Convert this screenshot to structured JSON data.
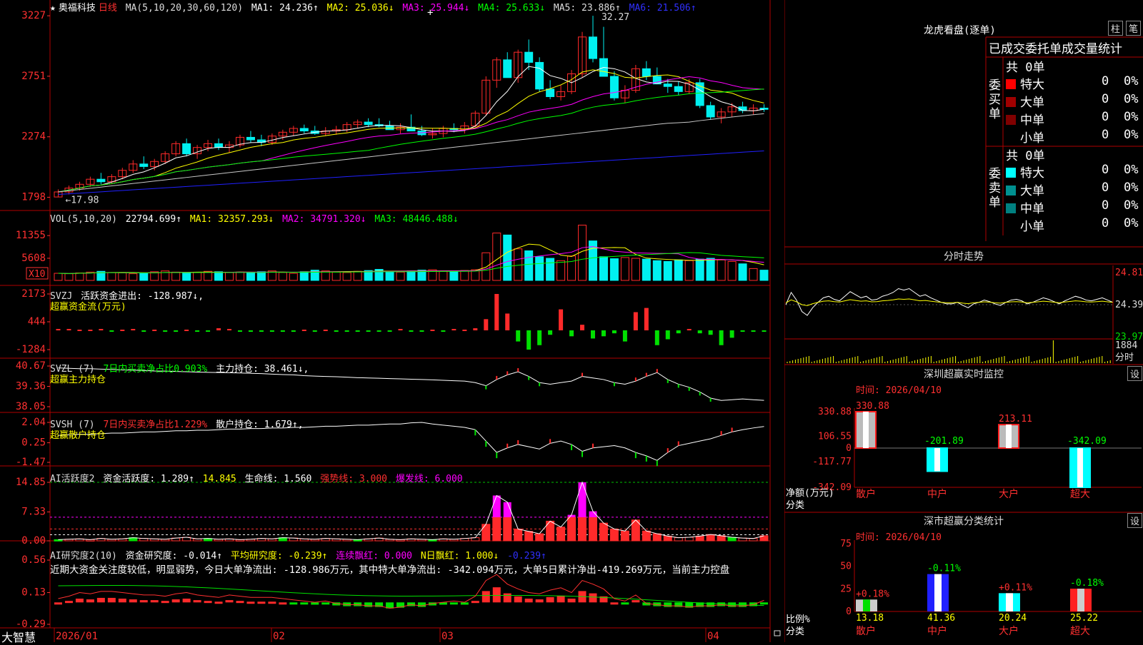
{
  "stock": {
    "star": "★",
    "name": "奥福科技",
    "period": "日线"
  },
  "colors": {
    "up": "#ff2a2a",
    "down": "#00f0f0",
    "ma1": "#ffffff",
    "ma2": "#ffff00",
    "ma3": "#ff00ff",
    "ma4": "#00ff00",
    "ma5": "#c8c8c8",
    "ma6": "#2020ff",
    "grid": "#b00000"
  },
  "main": {
    "ma_label": "MA(5,10,20,30,60,120)",
    "ma1": "MA1: 24.236↑",
    "ma2": "MA2: 25.036↓",
    "ma3": "MA3: 25.944↓",
    "ma4": "MA4: 25.633↓",
    "ma5": "MA5: 23.886↑",
    "ma6": "MA6: 21.506↑",
    "y_ticks": [
      "3227",
      "2751",
      "2274",
      "1798"
    ],
    "high_label": "32.27",
    "low_label": "←17.98",
    "plus": "+"
  },
  "vol": {
    "label": "VOL(5,10,20)",
    "value": "22794.699↑",
    "ma1": "MA1: 32357.293↓",
    "ma2": "MA2: 34791.320↓",
    "ma3": "MA3: 48446.488↓",
    "y_ticks": [
      "11355",
      "5608",
      "X10"
    ]
  },
  "svzj": {
    "label": "SVZJ",
    "desc": "活跃资金进出: -128.987↓,",
    "sub": "超赢资金流(万元)",
    "y_ticks": [
      "2173",
      "444",
      "-1284"
    ]
  },
  "svzl": {
    "label": "SVZL (7)",
    "desc1": "7日内买卖净占比0.903%",
    "desc2": "主力持仓: 38.461↓,",
    "sub": "超赢主力持仓",
    "y_ticks": [
      "40.67",
      "39.36",
      "38.05"
    ]
  },
  "svsh": {
    "label": "SVSH (7)",
    "desc1": "7日内买卖净占比1.229%",
    "desc2": "散户持仓: 1.679↑,",
    "sub": "超赢散户持仓",
    "y_ticks": [
      "2.04",
      "0.25",
      "-1.47"
    ]
  },
  "ai1": {
    "label": "AI活跃度2",
    "d1": "资金活跃度: 1.289↑",
    "d2": "14.845",
    "d3": "生命线: 1.560",
    "d4": "强势线: 3.000",
    "d5": "爆发线: 6.000",
    "y_ticks": [
      "14.85",
      "7.33",
      "0.00"
    ]
  },
  "ai2": {
    "label": "AI研究度2(10)",
    "d1": "资金研究度: -0.014↑",
    "d2": "平均研究度: -0.239↑",
    "d3": "连续飘红: 0.000",
    "d4": "N日飘红: 1.000↓",
    "d5": "-0.239↑",
    "comment": "近期大资金关注度较低，明显弱势，今日大单净流出: -128.986万元，其中特大单净流出: -342.094万元，大单5日累计净出-419.269万元，当前主力控盘",
    "y_ticks": [
      "0.56",
      "0.13",
      "-0.29"
    ]
  },
  "xaxis": {
    "logo": "大智慧",
    "dates": [
      "2026/01",
      "02",
      "03",
      "04"
    ]
  },
  "lhb": {
    "title": "龙虎看盘(逐单)",
    "btn1": "柱",
    "btn2": "笔",
    "tabs": [
      "已成交",
      "委托单",
      "成交量统计"
    ],
    "buy": {
      "group": "委买单",
      "total": "共 0单",
      "rows": [
        {
          "name": "特大",
          "v": "0",
          "p": "0%"
        },
        {
          "name": "大单",
          "v": "0",
          "p": "0%"
        },
        {
          "name": "中单",
          "v": "0",
          "p": "0%"
        },
        {
          "name": "小单",
          "v": "0",
          "p": "0%"
        }
      ]
    },
    "sell": {
      "group": "委卖单",
      "total": "共 0单",
      "rows": [
        {
          "name": "特大",
          "v": "0",
          "p": "0%"
        },
        {
          "name": "大单",
          "v": "0",
          "p": "0%"
        },
        {
          "name": "中单",
          "v": "0",
          "p": "0%"
        },
        {
          "name": "小单",
          "v": "0",
          "p": "0%"
        }
      ]
    }
  },
  "fenshi": {
    "title": "分时走势",
    "y_ticks": [
      "24.81",
      "24.39",
      "23.97"
    ],
    "vol_top": "1884",
    "vol_label": "分时"
  },
  "sz_monitor": {
    "title": "深圳超赢实时监控",
    "btn": "设",
    "time": "时间: 2026/04/10",
    "ylabel": "净额(万元)",
    "xlabel": "分类",
    "y_ticks": [
      "330.88",
      "106.55",
      "0",
      "-117.77",
      "-342.09"
    ]
  },
  "sz_class": {
    "title": "深市超赢分类统计",
    "btn": "设",
    "time": "时间: 2026/04/10",
    "ylabel": "比例%",
    "xlabel": "分类",
    "y_ticks": [
      "75",
      "50",
      "25",
      "0"
    ]
  },
  "chart_data": [
    {
      "type": "candlestick",
      "name": "奥福科技 日线",
      "ma_periods": [
        5,
        10,
        20,
        30,
        60,
        120
      ],
      "ohlc": [
        [
          18.0,
          18.6,
          17.98,
          18.4
        ],
        [
          18.4,
          18.9,
          18.2,
          18.7
        ],
        [
          18.7,
          19.2,
          18.5,
          19.0
        ],
        [
          19.0,
          19.6,
          18.8,
          19.4
        ],
        [
          19.4,
          19.9,
          19.0,
          19.2
        ],
        [
          19.2,
          19.8,
          19.0,
          19.6
        ],
        [
          19.6,
          20.3,
          19.4,
          20.1
        ],
        [
          20.1,
          20.9,
          19.9,
          20.6
        ],
        [
          20.6,
          21.2,
          20.2,
          20.4
        ],
        [
          20.4,
          21.0,
          20.1,
          20.8
        ],
        [
          20.8,
          21.6,
          20.6,
          21.4
        ],
        [
          21.4,
          22.4,
          21.2,
          22.2
        ],
        [
          22.2,
          22.6,
          21.2,
          21.4
        ],
        [
          21.4,
          22.1,
          21.0,
          21.9
        ],
        [
          21.9,
          22.5,
          21.6,
          22.2
        ],
        [
          22.2,
          22.6,
          21.7,
          21.9
        ],
        [
          21.9,
          22.4,
          21.5,
          22.1
        ],
        [
          22.1,
          22.9,
          21.9,
          22.7
        ],
        [
          22.7,
          23.2,
          22.3,
          22.5
        ],
        [
          22.5,
          22.9,
          22.0,
          22.3
        ],
        [
          22.3,
          23.0,
          22.1,
          22.8
        ],
        [
          22.8,
          23.3,
          22.5,
          23.1
        ],
        [
          23.1,
          23.6,
          22.8,
          23.4
        ],
        [
          23.4,
          23.7,
          23.0,
          23.2
        ],
        [
          23.2,
          23.6,
          22.9,
          23.0
        ],
        [
          23.0,
          23.5,
          22.8,
          23.2
        ],
        [
          23.2,
          23.6,
          22.9,
          23.3
        ],
        [
          23.3,
          23.9,
          23.1,
          23.7
        ],
        [
          23.7,
          24.1,
          23.4,
          23.9
        ],
        [
          23.9,
          24.2,
          23.5,
          23.7
        ],
        [
          23.7,
          24.2,
          23.5,
          23.6
        ],
        [
          23.6,
          24.0,
          23.3,
          23.3
        ],
        [
          23.3,
          23.8,
          23.0,
          23.5
        ],
        [
          23.5,
          24.5,
          23.2,
          23.2
        ],
        [
          23.2,
          23.6,
          22.8,
          22.9
        ],
        [
          22.9,
          23.4,
          22.6,
          23.0
        ],
        [
          23.0,
          23.6,
          22.7,
          23.4
        ],
        [
          23.4,
          23.8,
          23.1,
          23.3
        ],
        [
          23.3,
          23.9,
          23.0,
          23.6
        ],
        [
          23.6,
          24.8,
          23.5,
          24.6
        ],
        [
          24.6,
          27.5,
          24.4,
          27.2
        ],
        [
          27.2,
          29.0,
          26.6,
          28.8
        ],
        [
          28.8,
          29.4,
          27.6,
          27.4
        ],
        [
          27.4,
          29.6,
          27.0,
          29.4
        ],
        [
          29.4,
          30.4,
          28.0,
          28.6
        ],
        [
          28.6,
          29.0,
          26.3,
          26.5
        ],
        [
          26.5,
          27.2,
          25.7,
          25.9
        ],
        [
          25.9,
          26.8,
          25.6,
          26.3
        ],
        [
          26.3,
          28.0,
          26.1,
          27.7
        ],
        [
          27.7,
          31.0,
          27.4,
          30.6
        ],
        [
          30.6,
          32.27,
          28.6,
          28.9
        ],
        [
          28.9,
          31.4,
          27.8,
          27.5
        ],
        [
          27.5,
          27.9,
          25.6,
          25.8
        ],
        [
          25.8,
          26.8,
          25.4,
          26.4
        ],
        [
          26.4,
          28.4,
          26.2,
          28.1
        ],
        [
          28.1,
          28.7,
          27.2,
          27.5
        ],
        [
          27.5,
          28.2,
          26.9,
          26.9
        ],
        [
          26.9,
          27.3,
          26.2,
          26.7
        ],
        [
          26.7,
          27.1,
          26.0,
          26.3
        ],
        [
          26.3,
          27.3,
          26.1,
          27.0
        ],
        [
          27.0,
          27.3,
          25.0,
          25.2
        ],
        [
          25.2,
          25.5,
          24.1,
          24.3
        ],
        [
          24.3,
          25.0,
          23.8,
          24.7
        ],
        [
          24.7,
          25.4,
          24.3,
          25.1
        ],
        [
          25.1,
          25.5,
          24.6,
          24.8
        ],
        [
          24.8,
          25.3,
          24.5,
          25.0
        ],
        [
          25.0,
          25.3,
          24.7,
          24.9
        ]
      ],
      "ylim": [
        17.5,
        32.5
      ]
    }
  ],
  "lists": {
    "vol": [
      18,
      17,
      19,
      21,
      23,
      20,
      19,
      17,
      18,
      22,
      24,
      21,
      18,
      20,
      23,
      22,
      20,
      21,
      19,
      22,
      24,
      20,
      18,
      22,
      26,
      24,
      21,
      20,
      23,
      25,
      28,
      22,
      21,
      24,
      26,
      27,
      23,
      22,
      25,
      27,
      70,
      120,
      115,
      80,
      75,
      60,
      56,
      50,
      62,
      140,
      100,
      60,
      55,
      58,
      56,
      54,
      50,
      48,
      52,
      50,
      54,
      56,
      52,
      48,
      42,
      30,
      26
    ],
    "svzj": [
      10,
      10,
      5,
      5,
      10,
      -5,
      5,
      10,
      -10,
      5,
      -5,
      -8,
      5,
      -5,
      -10,
      15,
      10,
      -15,
      -20,
      -8,
      -10,
      -5,
      -5,
      5,
      -5,
      5,
      -10,
      -5,
      -10,
      -15,
      -5,
      -5,
      10,
      -10,
      -8,
      5,
      -5,
      10,
      5,
      15,
      80,
      260,
      120,
      -150,
      -260,
      -200,
      -60,
      150,
      -80,
      40,
      -110,
      -80,
      -40,
      -150,
      130,
      160,
      -200,
      -120,
      -40,
      10,
      -40,
      -60,
      -200,
      -100,
      -10,
      -5,
      -10
    ],
    "svzl": [
      40.55,
      40.52,
      40.5,
      40.5,
      40.47,
      40.45,
      40.42,
      40.4,
      40.38,
      40.35,
      40.34,
      40.32,
      40.3,
      40.28,
      40.26,
      40.25,
      40.24,
      40.22,
      40.2,
      40.18,
      40.15,
      40.12,
      40.1,
      40.05,
      40.02,
      40.0,
      39.98,
      39.95,
      39.92,
      39.9,
      39.88,
      39.86,
      39.84,
      39.82,
      39.8,
      39.78,
      39.75,
      39.72,
      39.7,
      39.6,
      39.4,
      39.8,
      40.1,
      40.3,
      40.0,
      39.6,
      39.5,
      39.6,
      39.7,
      40.0,
      39.9,
      39.8,
      39.6,
      39.5,
      39.7,
      40.0,
      40.25,
      39.8,
      39.5,
      39.3,
      39.0,
      38.6,
      38.45,
      38.5,
      38.55,
      38.5,
      38.46
    ],
    "svsh": [
      0.9,
      0.95,
      1.0,
      1.0,
      1.05,
      1.1,
      1.1,
      1.15,
      1.2,
      1.2,
      1.25,
      1.3,
      1.3,
      1.35,
      1.35,
      1.4,
      1.45,
      1.45,
      1.5,
      1.5,
      1.55,
      1.55,
      1.6,
      1.6,
      1.65,
      1.7,
      1.7,
      1.75,
      1.8,
      1.8,
      1.85,
      1.9,
      1.9,
      2.0,
      2.04,
      1.9,
      1.8,
      1.7,
      1.6,
      1.4,
      0.4,
      -0.6,
      -0.2,
      0.1,
      -0.1,
      -0.3,
      0.2,
      0.4,
      0.1,
      -0.5,
      -0.2,
      -0.1,
      0.0,
      -0.2,
      -0.6,
      -0.9,
      -1.3,
      -0.6,
      0.0,
      0.2,
      0.4,
      0.6,
      0.9,
      1.2,
      1.4,
      1.55,
      1.68
    ],
    "ai1": [
      0.3,
      0.4,
      0.5,
      0.3,
      0.6,
      0.4,
      0.5,
      0.8,
      0.6,
      0.5,
      0.4,
      0.7,
      0.9,
      0.5,
      0.6,
      0.4,
      0.5,
      0.3,
      0.4,
      0.6,
      0.5,
      0.8,
      0.7,
      0.5,
      0.4,
      0.6,
      0.5,
      0.4,
      0.3,
      0.5,
      0.7,
      0.4,
      0.3,
      0.5,
      0.4,
      0.3,
      0.5,
      0.4,
      0.6,
      0.8,
      4.2,
      11.5,
      9.8,
      3.0,
      2.4,
      1.8,
      5.0,
      3.5,
      6.6,
      14.85,
      7.5,
      4.5,
      3.0,
      2.5,
      5.3,
      2.5,
      1.8,
      1.2,
      0.8,
      0.9,
      1.2,
      1.6,
      1.3,
      0.9,
      0.7,
      0.6,
      1.289
    ],
    "ai2": [
      0.0,
      0.02,
      0.05,
      0.04,
      0.06,
      0.06,
      0.05,
      0.04,
      0.03,
      0.03,
      0.02,
      0.04,
      0.05,
      0.03,
      0.02,
      0.01,
      0.03,
      0.02,
      0.01,
      0.01,
      0.01,
      0.0,
      -0.01,
      -0.02,
      -0.03,
      -0.02,
      -0.04,
      -0.05,
      -0.05,
      -0.06,
      -0.06,
      -0.08,
      -0.07,
      -0.05,
      -0.06,
      -0.04,
      -0.03,
      -0.02,
      -0.03,
      0.02,
      0.15,
      0.2,
      0.12,
      0.08,
      0.05,
      0.04,
      0.07,
      0.09,
      0.05,
      0.15,
      0.12,
      0.08,
      0.0,
      -0.02,
      0.03,
      -0.04,
      -0.05,
      -0.06,
      -0.06,
      -0.07,
      -0.06,
      -0.06,
      -0.05,
      -0.06,
      -0.06,
      -0.05,
      -0.014
    ],
    "fenshi": [
      24.39,
      24.55,
      24.45,
      24.3,
      24.25,
      24.35,
      24.42,
      24.48,
      24.5,
      24.46,
      24.44,
      24.5,
      24.56,
      24.52,
      24.48,
      24.5,
      24.45,
      24.46,
      24.5,
      24.52,
      24.55,
      24.6,
      24.58,
      24.6,
      24.55,
      24.5,
      24.52,
      24.48,
      24.45,
      24.42,
      24.4,
      24.4,
      24.42,
      24.38,
      24.35,
      24.4,
      24.42,
      24.45,
      24.43,
      24.4,
      24.38,
      24.42,
      24.45,
      24.46,
      24.44,
      24.4,
      24.42,
      24.45,
      24.48,
      24.46,
      24.43,
      24.4,
      24.44,
      24.47,
      24.5,
      24.48,
      24.45,
      24.44,
      24.46,
      24.48,
      24.45,
      24.42
    ],
    "sz_net": [
      {
        "name": "散户",
        "v": 330.88,
        "label": "330.88"
      },
      {
        "name": "中户",
        "v": -201.89,
        "label": "-201.89"
      },
      {
        "name": "大户",
        "v": 213.11,
        "label": "213.11"
      },
      {
        "name": "超大",
        "v": -342.09,
        "label": "-342.09"
      }
    ],
    "sz_ratio": [
      {
        "name": "散户",
        "v": 13.18,
        "label": "13.18",
        "d": "+0.18%"
      },
      {
        "name": "中户",
        "v": 41.36,
        "label": "41.36",
        "d": "-0.11%"
      },
      {
        "name": "大户",
        "v": 20.24,
        "label": "20.24",
        "d": "+0.11%"
      },
      {
        "name": "超大",
        "v": 25.22,
        "label": "25.22",
        "d": "-0.18%"
      }
    ]
  }
}
